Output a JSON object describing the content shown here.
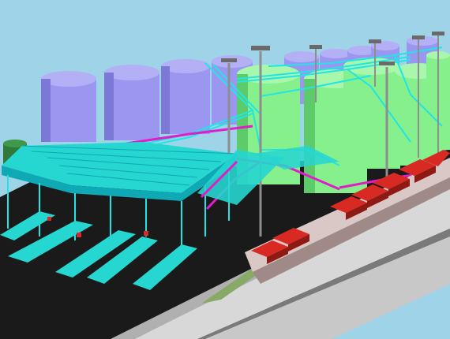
{
  "scene": {
    "kind": "3D plant model render",
    "colors": {
      "sky": "#9fd3e8",
      "ground": "#1a1a1a",
      "road": "#d8d8d8",
      "road_edge": "#b0b0b0",
      "curb": "#7a7a7a",
      "grass": "#88aa66",
      "tank_purple": "#9b97f0",
      "tank_purple_shade": "#7c78d6",
      "tank_green": "#86f08c",
      "tank_green_shade": "#5ecb6b",
      "tank_dark_green": "#2f7a3a",
      "steel_cyan": "#1fe6e6",
      "steel_cyan_dark": "#0fa8b5",
      "pipe_magenta": "#e21cc9",
      "loading_red": "#d82a22",
      "loading_red_dark": "#8f1a14",
      "pole_gray": "#8e8e8e",
      "bay_cyan": "#26d6d0"
    }
  }
}
